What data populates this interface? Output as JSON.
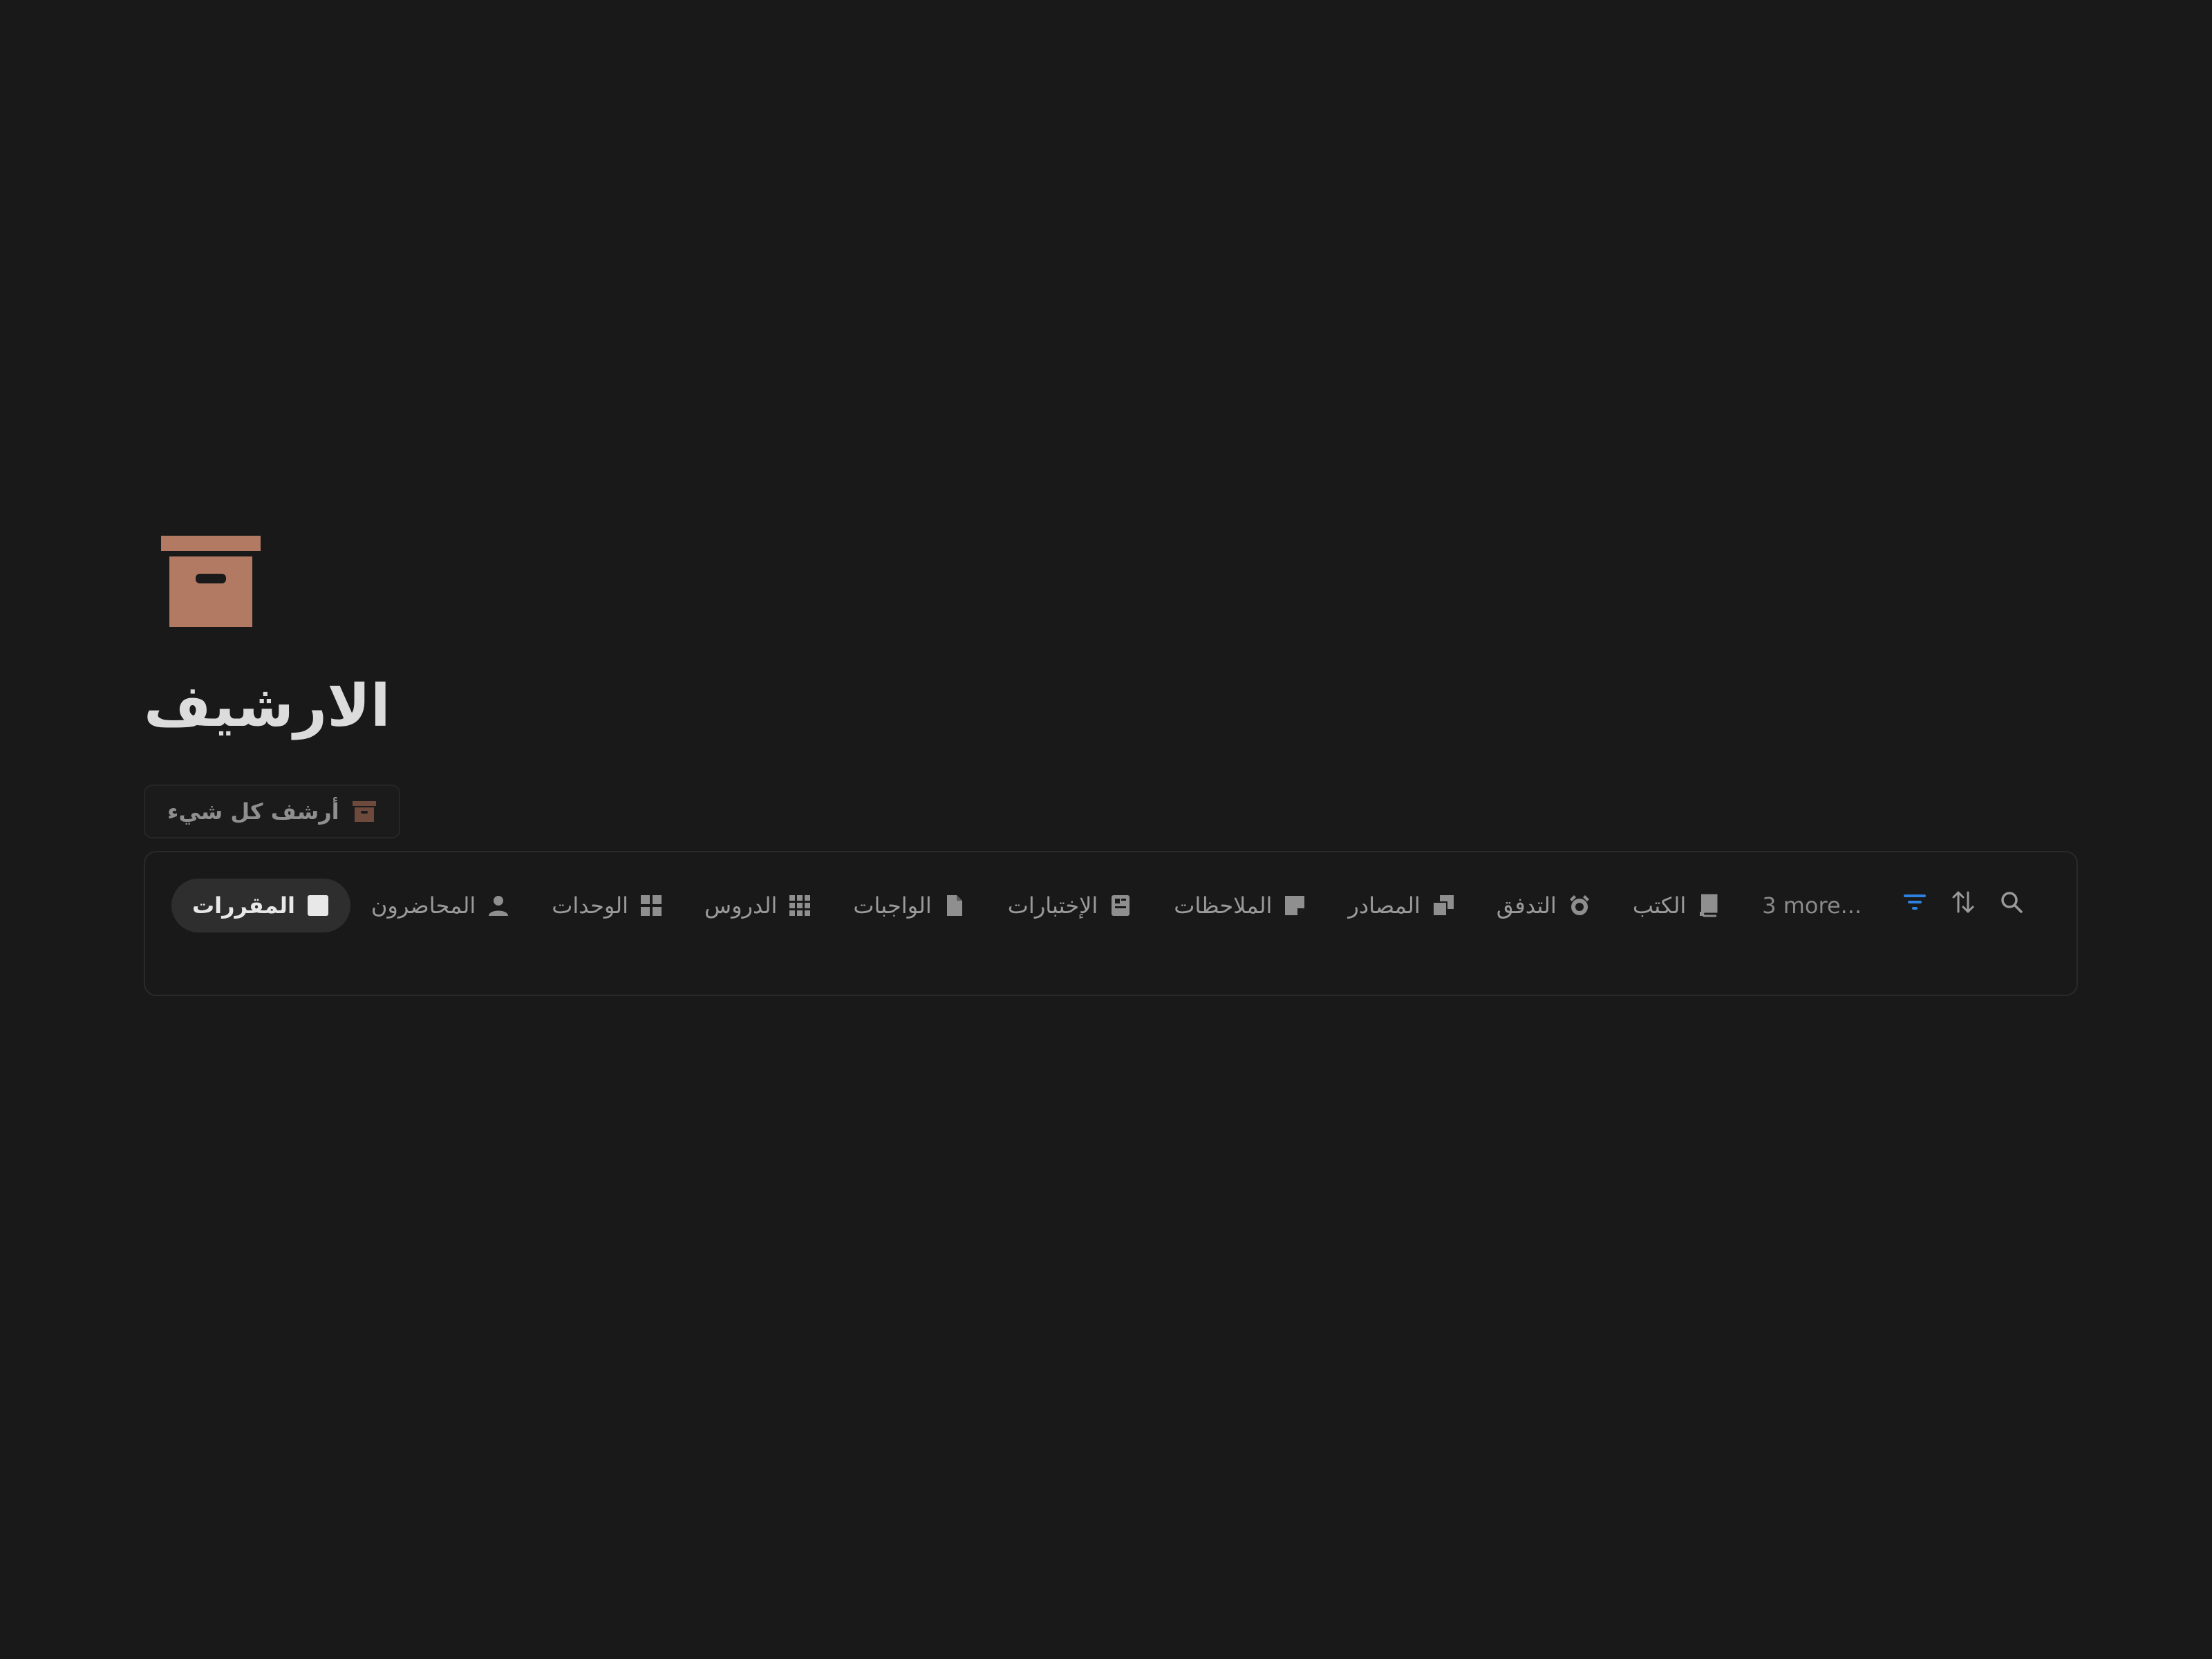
{
  "page": {
    "title": "الارشيف",
    "icon": "archive-box-icon",
    "accent_color": "#b27a63"
  },
  "archive_button": {
    "label": "أرشف كل شيء",
    "icon": "archive-box-icon"
  },
  "tabs": [
    {
      "label": "المقررات",
      "icon": "square-icon",
      "active": true
    },
    {
      "label": "المحاضرون",
      "icon": "person-icon"
    },
    {
      "label": "الوحدات",
      "icon": "grid-icon"
    },
    {
      "label": "الدروس",
      "icon": "dots-grid-icon"
    },
    {
      "label": "الواجبات",
      "icon": "document-icon"
    },
    {
      "label": "الإختبارات",
      "icon": "test-icon"
    },
    {
      "label": "الملاحظات",
      "icon": "sticky-note-icon"
    },
    {
      "label": "المصادر",
      "icon": "copy-icon"
    },
    {
      "label": "التدفق",
      "icon": "alarm-icon"
    },
    {
      "label": "الكتب",
      "icon": "book-icon"
    }
  ],
  "more_tabs": "3 more...",
  "toolbar": {
    "filter": {
      "icon": "filter-icon",
      "color": "#2f81e0"
    },
    "sort": {
      "icon": "sort-icon"
    },
    "search": {
      "icon": "search-icon"
    }
  }
}
